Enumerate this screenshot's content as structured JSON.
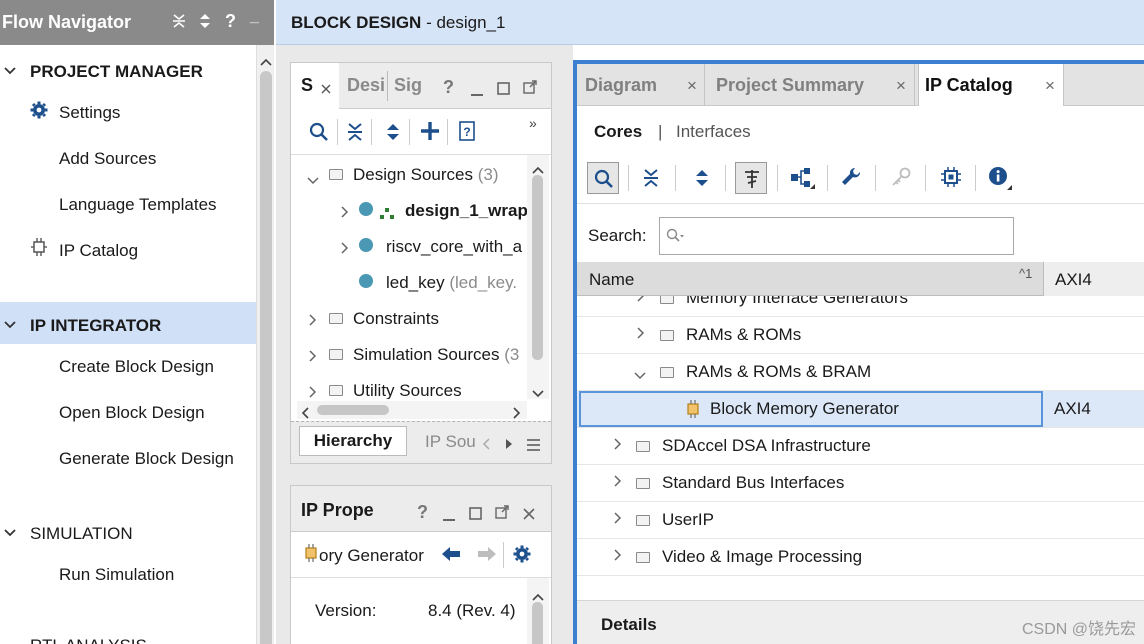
{
  "flow_navigator": {
    "title": "Flow Navigator",
    "header_icons": [
      "collapse-all-icon",
      "expand-icon",
      "help-icon",
      "minimize-icon"
    ],
    "help_glyph": "?",
    "minimize_glyph": "_",
    "sections": {
      "project_manager": {
        "label": "PROJECT MANAGER",
        "items": {
          "settings": "Settings",
          "add_sources": "Add Sources",
          "language_templates": "Language Templates",
          "ip_catalog": "IP Catalog"
        }
      },
      "ip_integrator": {
        "label": "IP INTEGRATOR",
        "items": {
          "create": "Create Block Design",
          "open": "Open Block Design",
          "generate": "Generate Block Design"
        }
      },
      "simulation": {
        "label": "SIMULATION",
        "items": {
          "run": "Run Simulation"
        }
      },
      "rtl_analysis": {
        "label": "RTL ANALYSIS"
      }
    }
  },
  "block_design": {
    "title_bold": "BLOCK DESIGN",
    "title_rest": " - design_1"
  },
  "sources_panel": {
    "tabs": {
      "sources": "S",
      "design": "Desi",
      "signals": "Sig"
    },
    "help_glyph": "?",
    "tree": {
      "design_sources": {
        "label": "Design Sources",
        "count": "(3)"
      },
      "design_1_wrapper": "design_1_wrap",
      "riscv_core": "riscv_core_with_a",
      "led_key": {
        "label": "led_key",
        "detail": "(led_key."
      },
      "constraints": "Constraints",
      "simulation_sources": {
        "label": "Simulation Sources",
        "count": "(3"
      },
      "utility_sources": "Utility Sources"
    },
    "bottom_tabs": {
      "hierarchy": "Hierarchy",
      "ip_sources": "IP Sou"
    }
  },
  "ip_properties": {
    "title": "IP Prope",
    "help_glyph": "?",
    "selected": "ory Generator",
    "version_label": "Version:",
    "version_value": "8.4 (Rev. 4)"
  },
  "main": {
    "tabs": {
      "diagram": "Diagram",
      "project_summary": "Project Summary",
      "ip_catalog": "IP Catalog"
    },
    "close_glyph": "×",
    "cores_tab": "Cores",
    "separator": "|",
    "interfaces_tab": "Interfaces",
    "search_label": "Search:",
    "search_value": "",
    "column_name": "Name",
    "sort_indicator": "^1",
    "column_axi": "AXI4",
    "rows": {
      "memory_interface": "Memory Interface Generators",
      "rams_roms": "RAMs & ROMs",
      "rams_roms_bram": "RAMs & ROMs & BRAM",
      "block_memory": {
        "label": "Block Memory Generator",
        "axi": "AXI4"
      },
      "sdaccel": "SDAccel DSA Infrastructure",
      "std_bus": "Standard Bus Interfaces",
      "userip": "UserIP",
      "video": "Video & Image Processing"
    },
    "details_label": "Details"
  },
  "watermark": "CSDN @饶先宏",
  "colors": {
    "accent": "#3d7fd1",
    "selection": "#dce8f8",
    "header_gray": "#8a8a8a",
    "dot": "#4a98b3"
  }
}
